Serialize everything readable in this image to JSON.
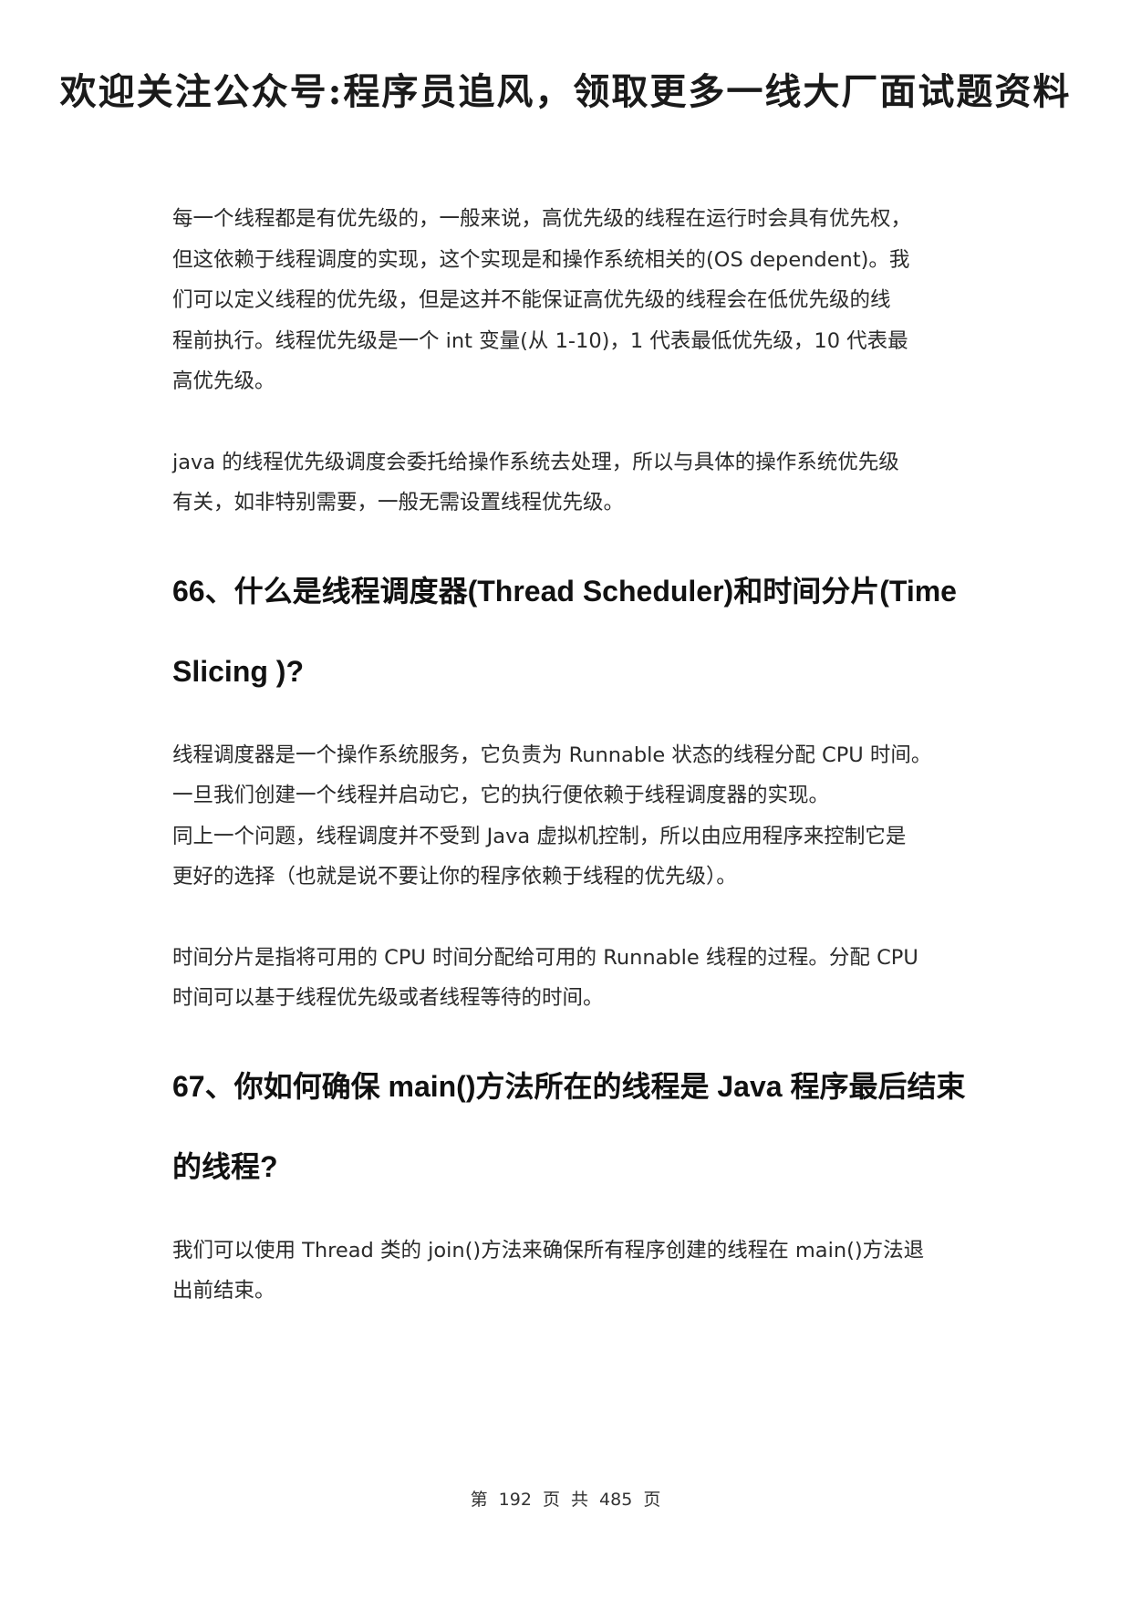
{
  "banner": "欢迎关注公众号:程序员追风，领取更多一线大厂面试题资料",
  "sections": [
    {
      "kind": "paragraph",
      "lines": [
        "每一个线程都是有优先级的，一般来说，高优先级的线程在运行时会具有优先权，",
        "但这依赖于线程调度的实现，这个实现是和操作系统相关的(OS dependent)。我",
        "们可以定义线程的优先级，但是这并不能保证高优先级的线程会在低优先级的线",
        "程前执行。线程优先级是一个 int 变量(从 1-10)，1 代表最低优先级，10 代表最",
        "高优先级。"
      ]
    },
    {
      "kind": "paragraph",
      "lines": [
        "java 的线程优先级调度会委托给操作系统去处理，所以与具体的操作系统优先级",
        "有关，如非特别需要，一般无需设置线程优先级。"
      ]
    },
    {
      "kind": "heading",
      "lines": [
        "66、什么是线程调度器(Thread Scheduler)和时间分片(Time",
        "Slicing )?"
      ]
    },
    {
      "kind": "paragraph",
      "lines": [
        "线程调度器是一个操作系统服务，它负责为 Runnable 状态的线程分配 CPU 时间。",
        "一旦我们创建一个线程并启动它，它的执行便依赖于线程调度器的实现。",
        "同上一个问题，线程调度并不受到 Java 虚拟机控制，所以由应用程序来控制它是",
        "更好的选择（也就是说不要让你的程序依赖于线程的优先级）。"
      ]
    },
    {
      "kind": "paragraph",
      "lines": [
        "时间分片是指将可用的 CPU 时间分配给可用的 Runnable 线程的过程。分配 CPU",
        "时间可以基于线程优先级或者线程等待的时间。"
      ]
    },
    {
      "kind": "heading",
      "lines": [
        "67、你如何确保 main()方法所在的线程是 Java 程序最后结束",
        "的线程?"
      ]
    },
    {
      "kind": "paragraph",
      "lines": [
        "我们可以使用 Thread 类的 join()方法来确保所有程序创建的线程在 main()方法退",
        "出前结束。"
      ]
    }
  ],
  "footer": "第 192 页 共 485 页"
}
